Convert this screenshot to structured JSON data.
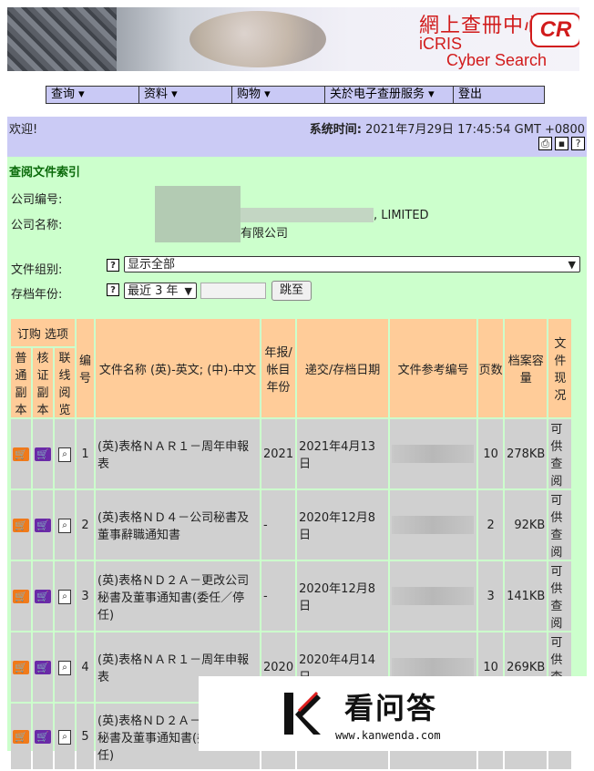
{
  "banner": {
    "brand_cn": "網上查冊中心",
    "brand_cr": "CR",
    "brand_icris": "iCRIS",
    "brand_cyber": "Cyber Search Centre"
  },
  "menu": {
    "items": [
      "查询 ▾",
      "资料 ▾",
      "购物 ▾",
      "关於电子查册服务 ▾",
      "登出"
    ]
  },
  "welcome": {
    "greeting": "欢迎!",
    "systime_label": "系统时间:",
    "systime_value": "2021年7月29日 17:45:54 GMT +0800"
  },
  "page": {
    "title": "查阅文件索引",
    "company_no_label": "公司编号:",
    "company_name_label": "公司名称:",
    "company_name_en_suffix": ", LIMITED",
    "company_name_cn_suffix": "有限公司",
    "doc_group_label": "文件组别:",
    "doc_group_value": "显示全部",
    "year_label": "存档年份:",
    "year_value": "最近 3 年",
    "go_button": "跳至"
  },
  "table": {
    "header_order": "订购 选项",
    "h_copy": "普通副本",
    "h_cert": "核证副本",
    "h_online": "联线阅览",
    "h_no": "编号",
    "h_name": "文件名称 (英)-英文; (中)-中文",
    "h_year": "年报/帐目年份",
    "h_date": "递交/存档日期",
    "h_ref": "文件参考编号",
    "h_pages": "页数",
    "h_size": "档案容量",
    "h_status": "文件现况",
    "rows": [
      {
        "no": "1",
        "name": "(英)表格ＮＡＲ１－周年申報表",
        "year": "2021",
        "date": "2021年4月13日",
        "pages": "10",
        "size": "278KB",
        "status": "可供查阅"
      },
      {
        "no": "2",
        "name": "(英)表格ＮＤ４－公司秘書及董事辭職通知書",
        "year": "-",
        "date": "2020年12月8日",
        "pages": "2",
        "size": "92KB",
        "status": "可供查阅"
      },
      {
        "no": "3",
        "name": "(英)表格ＮＤ２Ａ－更改公司秘書及董事通知書(委任／停任)",
        "year": "-",
        "date": "2020年12月8日",
        "pages": "3",
        "size": "141KB",
        "status": "可供查阅"
      },
      {
        "no": "4",
        "name": "(英)表格ＮＡＲ１－周年申報表",
        "year": "2020",
        "date": "2020年4月14日",
        "pages": "10",
        "size": "269KB",
        "status": "可供查阅"
      },
      {
        "no": "5",
        "name": "(英)表格ＮＤ２Ａ－更改公司秘書及董事通知書(委任／停任)",
        "year": "",
        "date": "",
        "pages": "",
        "size": "",
        "status": ""
      }
    ]
  },
  "watermark": {
    "brand": "看问答",
    "url": "www.kanwenda.com"
  }
}
